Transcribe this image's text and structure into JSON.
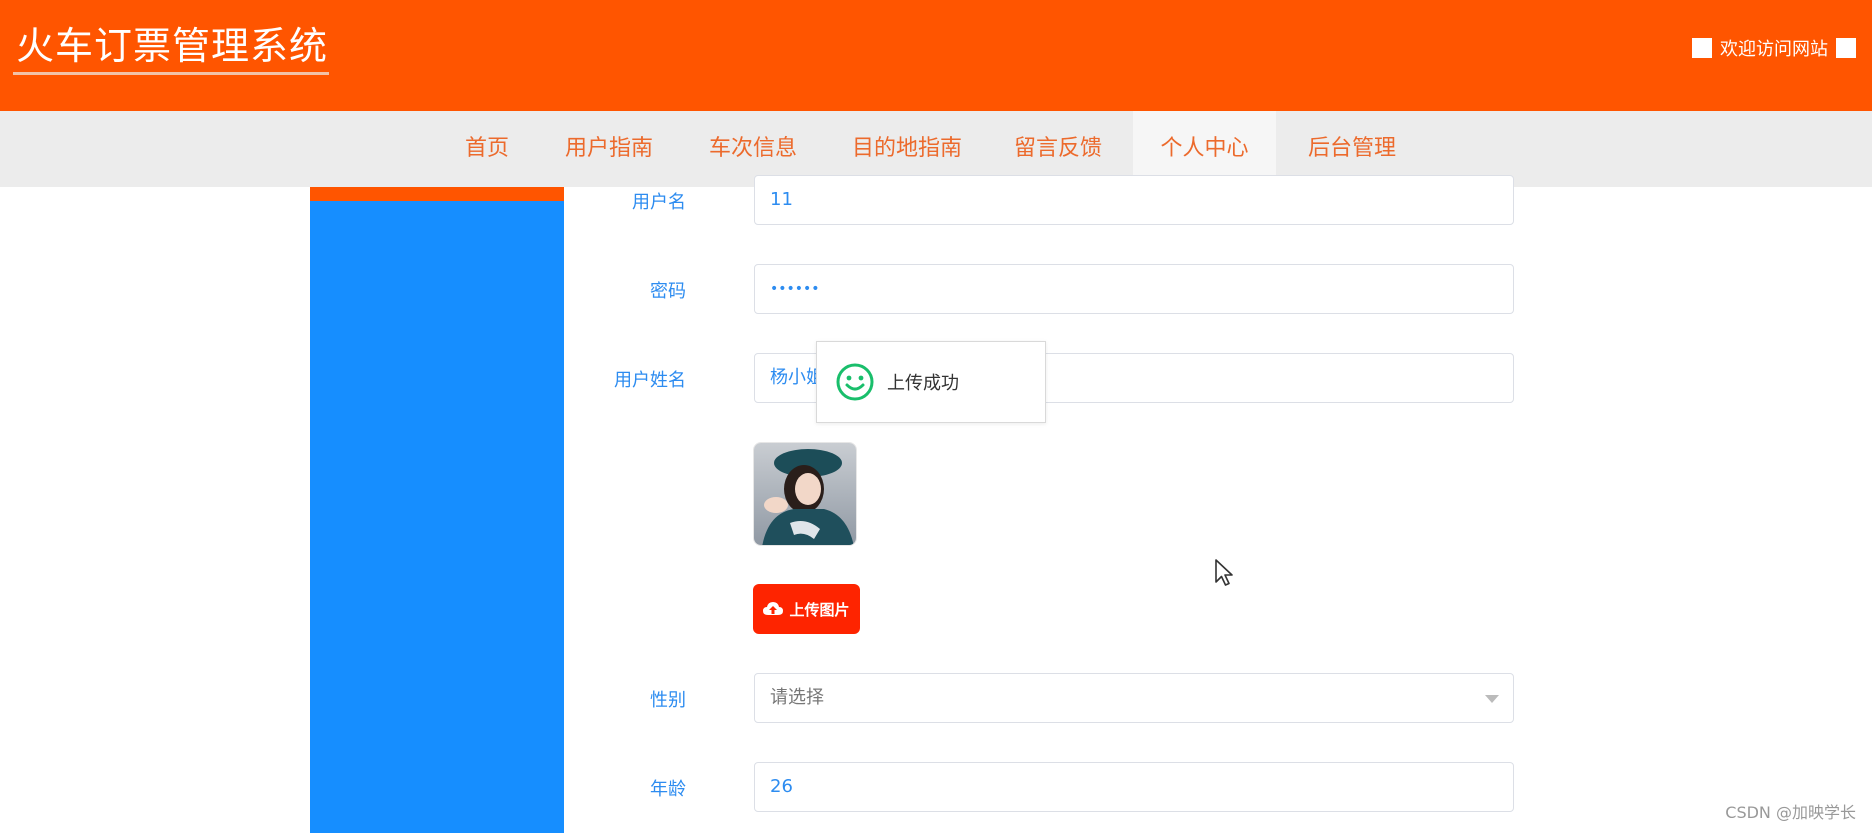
{
  "header": {
    "site_title": "火车订票管理系统",
    "welcome_text": "欢迎访问网站"
  },
  "nav": {
    "items": [
      {
        "label": "首页",
        "active": false
      },
      {
        "label": "用户指南",
        "active": false
      },
      {
        "label": "车次信息",
        "active": false
      },
      {
        "label": "目的地指南",
        "active": false
      },
      {
        "label": "留言反馈",
        "active": false
      },
      {
        "label": "个人中心",
        "active": true
      },
      {
        "label": "后台管理",
        "active": false
      }
    ]
  },
  "form": {
    "username": {
      "label": "用户名",
      "value": "11"
    },
    "password": {
      "label": "密码",
      "value": "••••••"
    },
    "real_name": {
      "label": "用户姓名",
      "value": "杨小姐"
    },
    "upload_button": "上传图片",
    "gender": {
      "label": "性别",
      "placeholder": "请选择"
    },
    "age": {
      "label": "年龄",
      "value": "26"
    }
  },
  "toast": {
    "message": "上传成功"
  },
  "watermark": "CSDN @加映学长",
  "colors": {
    "header_bg": "#ff5500",
    "nav_bg": "#ececec",
    "nav_text": "#ec6a2c",
    "sidebar_bg": "#168eff",
    "label_color": "#2d8cf0",
    "upload_button_bg": "#fe2400",
    "toast_icon": "#19be6b"
  },
  "icons": {
    "toast_icon": "smile-icon",
    "upload_icon": "cloud-upload-icon",
    "select_icon": "caret-down-icon"
  }
}
